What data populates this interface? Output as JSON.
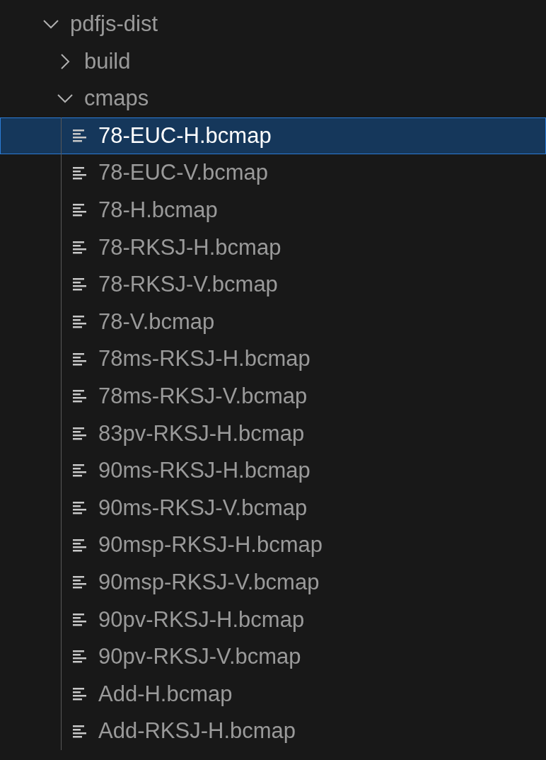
{
  "tree": [
    {
      "label": "pdfjs-dist",
      "kind": "folder",
      "expanded": true,
      "selected": false,
      "children": [
        {
          "label": "build",
          "kind": "folder",
          "expanded": false,
          "selected": false
        },
        {
          "label": "cmaps",
          "kind": "folder",
          "expanded": true,
          "selected": false,
          "children": [
            {
              "label": "78-EUC-H.bcmap",
              "kind": "file",
              "selected": true
            },
            {
              "label": "78-EUC-V.bcmap",
              "kind": "file",
              "selected": false
            },
            {
              "label": "78-H.bcmap",
              "kind": "file",
              "selected": false
            },
            {
              "label": "78-RKSJ-H.bcmap",
              "kind": "file",
              "selected": false
            },
            {
              "label": "78-RKSJ-V.bcmap",
              "kind": "file",
              "selected": false
            },
            {
              "label": "78-V.bcmap",
              "kind": "file",
              "selected": false
            },
            {
              "label": "78ms-RKSJ-H.bcmap",
              "kind": "file",
              "selected": false
            },
            {
              "label": "78ms-RKSJ-V.bcmap",
              "kind": "file",
              "selected": false
            },
            {
              "label": "83pv-RKSJ-H.bcmap",
              "kind": "file",
              "selected": false
            },
            {
              "label": "90ms-RKSJ-H.bcmap",
              "kind": "file",
              "selected": false
            },
            {
              "label": "90ms-RKSJ-V.bcmap",
              "kind": "file",
              "selected": false
            },
            {
              "label": "90msp-RKSJ-H.bcmap",
              "kind": "file",
              "selected": false
            },
            {
              "label": "90msp-RKSJ-V.bcmap",
              "kind": "file",
              "selected": false
            },
            {
              "label": "90pv-RKSJ-H.bcmap",
              "kind": "file",
              "selected": false
            },
            {
              "label": "90pv-RKSJ-V.bcmap",
              "kind": "file",
              "selected": false
            },
            {
              "label": "Add-H.bcmap",
              "kind": "file",
              "selected": false
            },
            {
              "label": "Add-RKSJ-H.bcmap",
              "kind": "file",
              "selected": false
            }
          ]
        }
      ]
    }
  ]
}
